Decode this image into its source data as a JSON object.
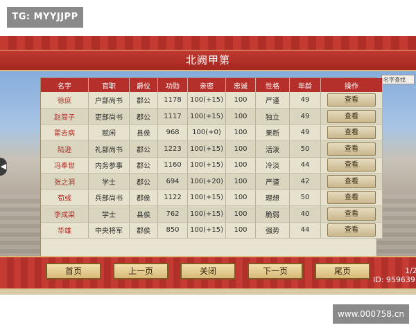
{
  "overlay": {
    "tg_label": "TG: MYYJJPP",
    "site_label": "www.000758.cn"
  },
  "window": {
    "title": "北阙甲第"
  },
  "search": {
    "placeholder": "名字查找"
  },
  "table": {
    "headers": [
      "名字",
      "官职",
      "爵位",
      "功勋",
      "亲密",
      "忠诚",
      "性格",
      "年龄",
      "操作"
    ],
    "rows": [
      {
        "name": "徐庶",
        "office": "户部尚书",
        "rank": "郡公",
        "merit": "1178",
        "intimacy": "100(+15)",
        "loyalty": "100",
        "personality": "严谨",
        "age": "49",
        "action": "查看"
      },
      {
        "name": "赵简子",
        "office": "吏部尚书",
        "rank": "郡公",
        "merit": "1117",
        "intimacy": "100(+15)",
        "loyalty": "100",
        "personality": "独立",
        "age": "49",
        "action": "查看"
      },
      {
        "name": "霍去病",
        "office": "赋闲",
        "rank": "县侯",
        "merit": "968",
        "intimacy": "100(+0)",
        "loyalty": "100",
        "personality": "果断",
        "age": "49",
        "action": "查看"
      },
      {
        "name": "陆逊",
        "office": "礼部尚书",
        "rank": "郡公",
        "merit": "1223",
        "intimacy": "100(+15)",
        "loyalty": "100",
        "personality": "活泼",
        "age": "50",
        "action": "查看"
      },
      {
        "name": "冯奉世",
        "office": "内务参事",
        "rank": "郡公",
        "merit": "1160",
        "intimacy": "100(+15)",
        "loyalty": "100",
        "personality": "冷淡",
        "age": "44",
        "action": "查看"
      },
      {
        "name": "张之洞",
        "office": "学士",
        "rank": "郡公",
        "merit": "694",
        "intimacy": "100(+20)",
        "loyalty": "100",
        "personality": "严谨",
        "age": "42",
        "action": "查看"
      },
      {
        "name": "荀彧",
        "office": "兵部尚书",
        "rank": "郡侯",
        "merit": "1122",
        "intimacy": "100(+15)",
        "loyalty": "100",
        "personality": "理想",
        "age": "50",
        "action": "查看"
      },
      {
        "name": "李成梁",
        "office": "学士",
        "rank": "县侯",
        "merit": "762",
        "intimacy": "100(+15)",
        "loyalty": "100",
        "personality": "脆弱",
        "age": "40",
        "action": "查看"
      },
      {
        "name": "华雄",
        "office": "中央将军",
        "rank": "郡侯",
        "merit": "850",
        "intimacy": "100(+15)",
        "loyalty": "100",
        "personality": "强势",
        "age": "44",
        "action": "查看"
      }
    ]
  },
  "nav": {
    "first": "首页",
    "prev": "上一页",
    "close": "关闭",
    "next": "下一页",
    "last": "尾页"
  },
  "footer": {
    "page": "1/2",
    "player_id": "ID: 959639"
  },
  "icons": {
    "left_arrow": "chevron-left-icon"
  },
  "colors": {
    "accent_red": "#b5302a",
    "gold": "#e0b978",
    "name_red": "#b32a24"
  }
}
